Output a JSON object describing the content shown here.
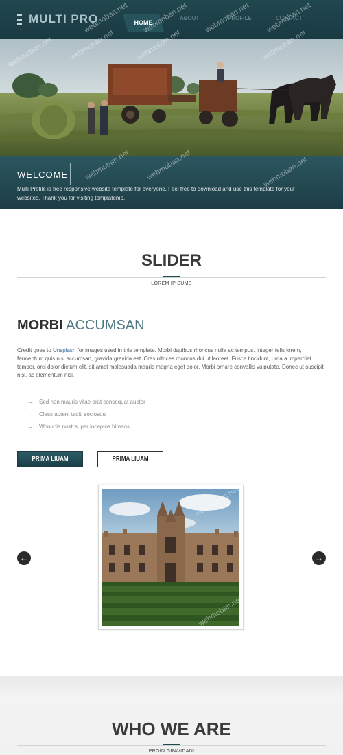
{
  "header": {
    "brand": "MULTI PRO",
    "nav": [
      {
        "label": "HOME"
      },
      {
        "label": "ABOUT"
      },
      {
        "label": "PROFILE"
      },
      {
        "label": "CONTACT"
      }
    ]
  },
  "hero": {
    "image": "farm-horses-baler-photo",
    "welcome_title": "WELCOME",
    "welcome_text": "Multi Profile is free responsive website template for everyone. Feel free to download and use this template for your websites. Thank you for visiting templatemo."
  },
  "slider_section": {
    "title": "SLIDER",
    "subtitle": "LOREM IP SUMS"
  },
  "morbi": {
    "title_strong": "MORBI",
    "title_accent": "ACCUMSAN",
    "para_prefix": "Credit goes to ",
    "para_link": "Unsplash",
    "para_rest": " for images used in this template. Morbi dapibus rhoncus nulla ac tempus. Integer felis lorem, fermentum quis nisl accumsan, gravida gravida est. Cras ultrices rhoncus dui ut laoreet. Fusce tincidunt, urna a imperdiet tempor, orci dolor dictum elit, sit amet malesuada mauris magna eget dolor. Morbi ornare convallis vulputate. Donec ut suscipit nisl, ac elementum nisi.",
    "bullets": [
      "Sed non mauris vitae erat consequat auctor",
      "Class aptent taciti sociosqu",
      "Wonubia nostra, per inceptos himeos"
    ],
    "button_primary": "PRIMA LIUAM",
    "button_secondary": "PRIMA LIUAM"
  },
  "slider": {
    "image": "college-building-photo",
    "prev_icon": "arrow-left-circle-icon",
    "next_icon": "arrow-right-circle-icon"
  },
  "who_section": {
    "title": "WHO WE ARE",
    "subtitle": "PROIN GRAVIDANI"
  },
  "watermark": "webmoban.net",
  "colors": {
    "primary": "#1f444c",
    "accent": "#4e7880",
    "link": "#3c6f9c"
  }
}
